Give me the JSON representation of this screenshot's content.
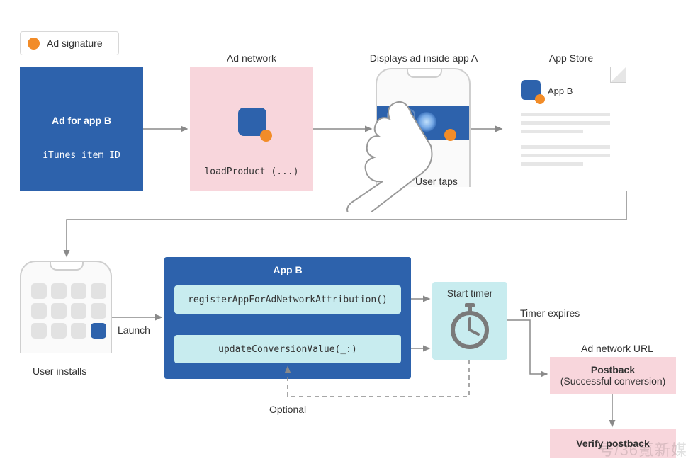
{
  "legend": {
    "label": "Ad signature"
  },
  "row1": {
    "ad_card": {
      "title": "Ad for app B",
      "subtitle": "iTunes item ID"
    },
    "ad_network": {
      "label": "Ad network",
      "code": "loadProduct (...)"
    },
    "phone": {
      "label": "Displays ad inside app A",
      "user_taps": "User taps"
    },
    "store": {
      "label": "App Store",
      "app_label": "App B"
    }
  },
  "row2": {
    "phoneB": {
      "caption": "User installs",
      "launch": "Launch"
    },
    "appB": {
      "title": "App B",
      "register": "registerAppForAdNetworkAttribution()",
      "update": "updateConversionValue(_:)",
      "optional": "Optional"
    },
    "timer": {
      "title": "Start timer",
      "expires": "Timer expires"
    },
    "postback": {
      "url_label": "Ad network URL",
      "title": "Postback",
      "subtitle": "(Successful conversion)"
    },
    "verify": {
      "title": "Verify postback"
    }
  },
  "watermark": "号/36氪新媒"
}
